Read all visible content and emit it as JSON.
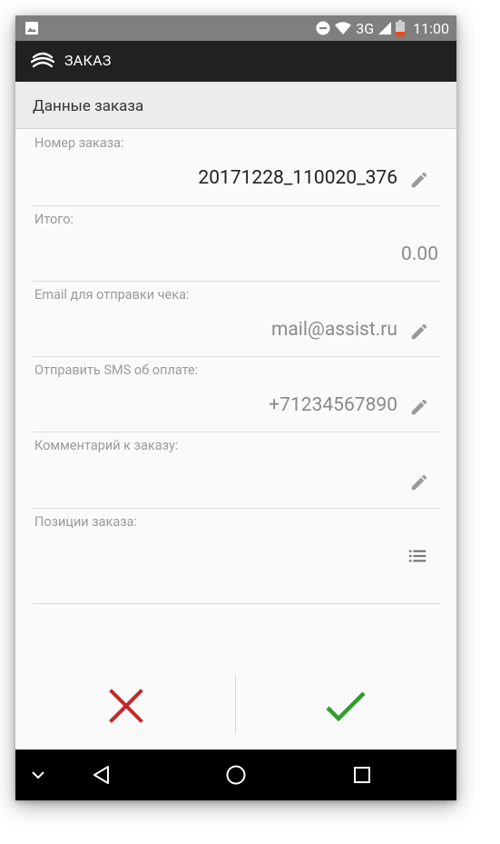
{
  "status_bar": {
    "network": "3G",
    "time": "11:00"
  },
  "app_bar": {
    "title": "ЗАКАЗ",
    "logo_icon": "assist-logo-icon"
  },
  "section": {
    "title": "Данные заказа"
  },
  "fields": [
    {
      "label": "Номер заказа:",
      "value": "20171228_110020_376",
      "icon": "pencil-icon"
    },
    {
      "label": "Итого:",
      "value": "0.00"
    },
    {
      "label": "Email для отправки чека:",
      "value": "mail@assist.ru",
      "icon": "pencil-icon"
    },
    {
      "label": "Отправить SMS об оплате:",
      "value": "+71234567890",
      "icon": "pencil-icon"
    },
    {
      "label": "Комментарий к заказу:",
      "value": "",
      "icon": "pencil-icon"
    },
    {
      "label": "Позиции заказа:",
      "value": "",
      "icon": "list-icon"
    }
  ],
  "actions": {
    "cancel_icon": "close-icon",
    "confirm_icon": "check-icon"
  },
  "colors": {
    "status_bar": "#7f7f7f",
    "app_bar": "#212121",
    "cancel": "#c62828",
    "confirm": "#2e9e2e",
    "battery_low": "#e64a19"
  }
}
